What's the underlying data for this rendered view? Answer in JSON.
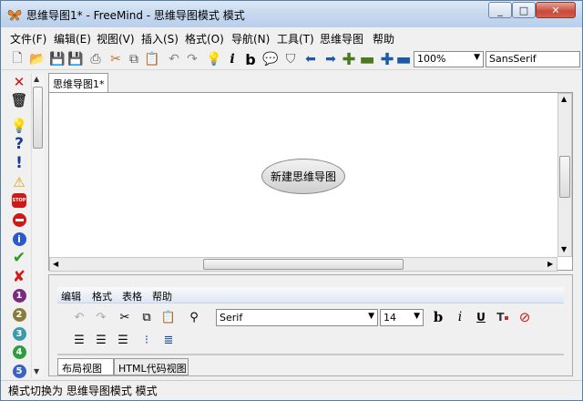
{
  "window": {
    "title": "思维导图1* - FreeMind - 思维导图模式 模式",
    "controls": [
      "_",
      "□",
      "✕"
    ]
  },
  "menu": [
    "文件(F)",
    "编辑(E)",
    "视图(V)",
    "插入(S)",
    "格式(O)",
    "导航(N)",
    "工具(T)",
    "思维导图",
    "帮助"
  ],
  "toolbar": {
    "zoom": "100%",
    "font": "SansSerif"
  },
  "tabs": {
    "map_tab": "思维导图1*"
  },
  "map": {
    "root_node": "新建思维导图"
  },
  "note_editor": {
    "menu": [
      "编辑",
      "格式",
      "表格",
      "帮助"
    ],
    "font": "Serif",
    "size": "14",
    "bold": "b",
    "italic": "i",
    "underline": "U"
  },
  "view_tabs": [
    "布局视图",
    "HTML代码视图"
  ],
  "status": "模式切换为 思维导图模式 模式",
  "icon_panel": {
    "numbers": [
      "1",
      "2",
      "3",
      "4",
      "5"
    ]
  },
  "colors": {
    "number_1": "#7b2b7f",
    "number_2": "#8a7b3a",
    "number_3": "#3a9aaa",
    "number_4": "#2e9e3e",
    "number_5": "#3a63c0"
  }
}
